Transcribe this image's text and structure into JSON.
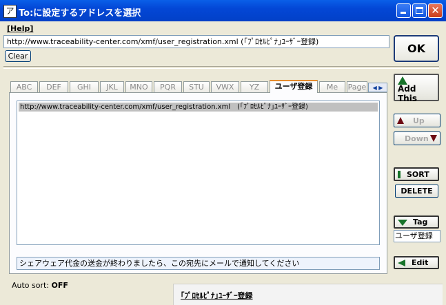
{
  "window": {
    "title": "To:に設定するアドレスを選択",
    "app_icon": "ア"
  },
  "help_link": "[Help]",
  "url_input": {
    "value": "http://www.traceability-center.com/xmf/user_registration.xml (｢ﾌﾟﾛｾﾙﾋﾟﾅ｣ﾕｰｻﾞｰ登録)"
  },
  "clear_button": "Clear",
  "ok_button": "OK",
  "tabs": [
    {
      "label": "ABC",
      "w": 0
    },
    {
      "label": "DEF"
    },
    {
      "label": "GHI"
    },
    {
      "label": "JKL"
    },
    {
      "label": "MNO"
    },
    {
      "label": "PQR"
    },
    {
      "label": "STU"
    },
    {
      "label": "VWX"
    },
    {
      "label": "YZ"
    },
    {
      "label": "ユーザ登録",
      "active": true
    },
    {
      "label": "Me"
    },
    {
      "label": "Page"
    }
  ],
  "list": {
    "items": [
      "http://www.traceability-center.com/xmf/user_registration.xml　(｢ﾌﾟﾛｾﾙﾋﾟﾅ｣ﾕｰｻﾞｰ登録)"
    ]
  },
  "notice": "シェアウェア代金の送金が終わりましたら、この宛先にメールで通知してください",
  "side": {
    "add_this": "Add This",
    "up": "Up",
    "down": "Down",
    "sort": "SORT",
    "delete": "DELETE",
    "tag": "Tag",
    "tag_value": "ユーザ登録",
    "edit": "Edit"
  },
  "auto_sort": {
    "label": "Auto sort:",
    "value": "OFF"
  },
  "bottom_title": "｢ﾌﾟﾛｾﾙﾋﾟﾅ｣ﾕｰｻﾞｰ登録",
  "colors": {
    "titlebar": "#0347d6",
    "accent_green": "#17732a",
    "arrow_dark_red": "#6d0a12"
  }
}
